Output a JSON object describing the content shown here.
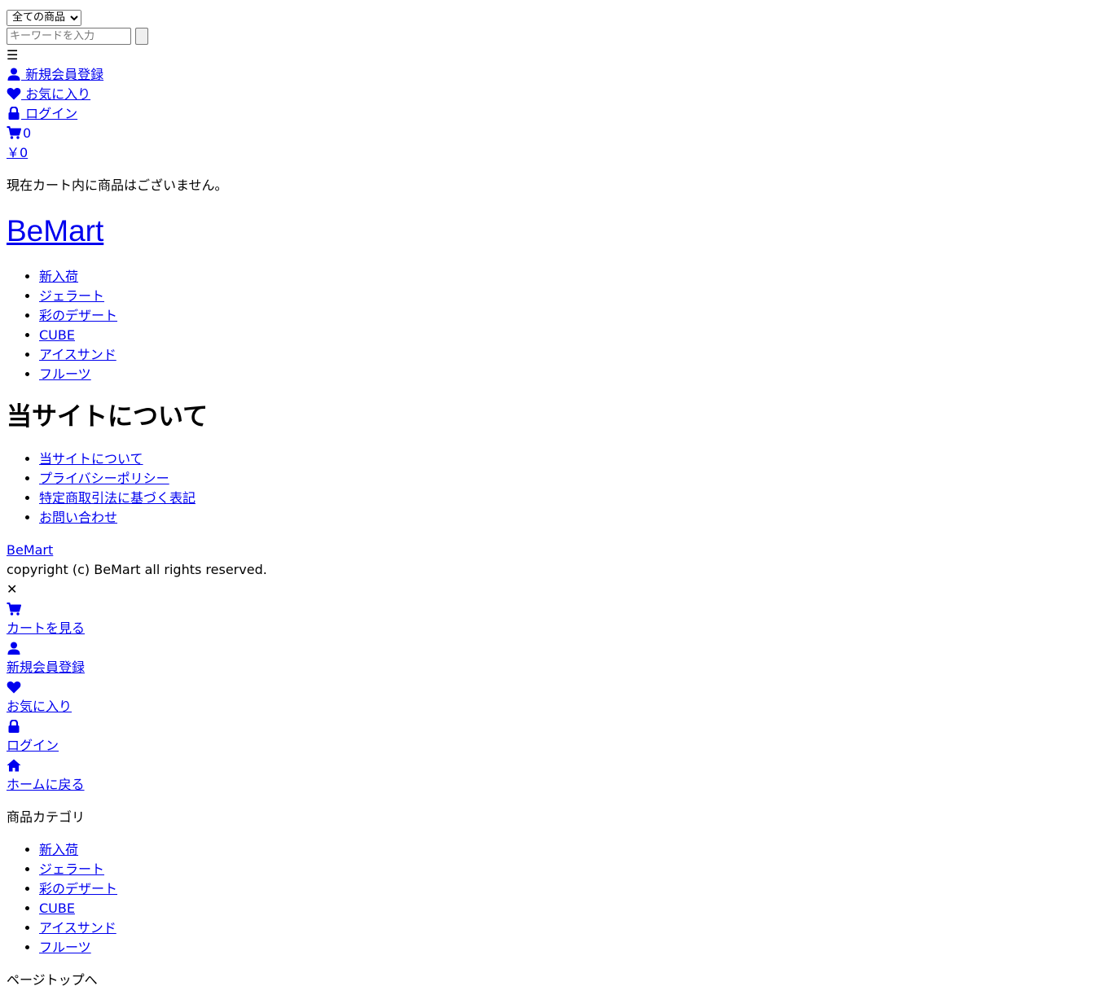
{
  "search": {
    "category_selected": "全ての商品",
    "keyword_placeholder": "キーワードを入力"
  },
  "header": {
    "menu_icon": "☰",
    "register_label": " 新規会員登録",
    "favorites_label": " お気に入り",
    "login_label": " ログイン",
    "cart_count": "0",
    "cart_total": "￥0",
    "cart_empty_message": "現在カート内に商品はございません。",
    "site_title": "BeMart"
  },
  "categories": [
    "新入荷",
    "ジェラート",
    "彩のデザート",
    "CUBE",
    "アイスサンド",
    "フルーツ"
  ],
  "about": {
    "heading": "当サイトについて",
    "links": [
      "当サイトについて",
      "プライバシーポリシー",
      "特定商取引法に基づく表記",
      "お問い合わせ"
    ]
  },
  "footer": {
    "brand": "BeMart",
    "copyright": "copyright (c) BeMart all rights reserved."
  },
  "drawer": {
    "close_icon": "✕",
    "view_cart": "カートを見る",
    "register": "新規会員登録",
    "favorites": "お気に入り",
    "login": "ログイン",
    "home": "ホームに戻る",
    "category_heading": "商品カテゴリ",
    "categories": [
      "新入荷",
      "ジェラート",
      "彩のデザート",
      "CUBE",
      "アイスサンド",
      "フルーツ"
    ],
    "page_top": "ページトップへ"
  },
  "colors": {
    "link": "#0000ee",
    "text": "#000000"
  },
  "icons": [
    "user-icon",
    "heart-icon",
    "lock-icon",
    "cart-icon",
    "home-icon",
    "menu-icon",
    "close-icon"
  ]
}
